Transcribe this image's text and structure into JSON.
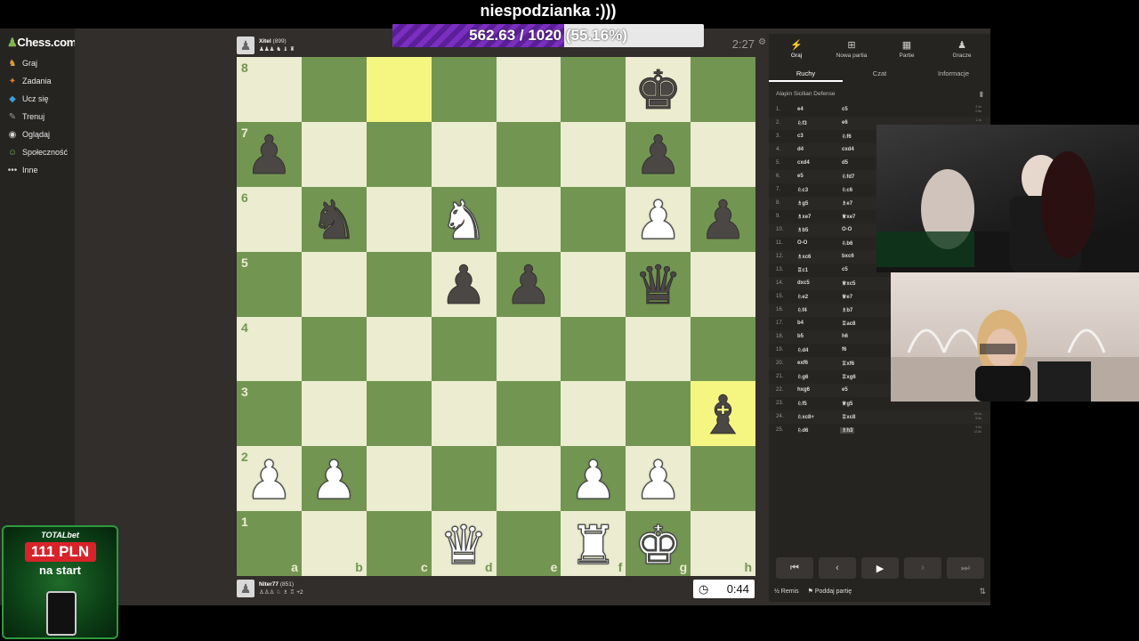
{
  "overlay": {
    "banner": "niespodzianka :)))",
    "goal_text": "562.63 / 1020 (55.16%)",
    "goal_progress": 0.5516
  },
  "sidebar": {
    "logo": "Chess.com",
    "items": [
      {
        "label": "Graj",
        "icon": "play-icon"
      },
      {
        "label": "Zadania",
        "icon": "puzzle-icon"
      },
      {
        "label": "Ucz się",
        "icon": "learn-icon"
      },
      {
        "label": "Trenuj",
        "icon": "train-icon"
      },
      {
        "label": "Oglądaj",
        "icon": "watch-icon"
      },
      {
        "label": "Społeczność",
        "icon": "community-icon"
      },
      {
        "label": "Inne",
        "icon": "more-icon"
      }
    ]
  },
  "top_player": {
    "name": "Xitel",
    "rating": "(899)",
    "captured": "♟♟♟ ♞ ♝ ♜",
    "clock": "2:27"
  },
  "bottom_player": {
    "name": "Niter77",
    "rating": "(851)",
    "captured": "♙♙♙ ♘ ♗ ♖",
    "advantage": "+2",
    "clock": "0:44"
  },
  "board": {
    "files": [
      "a",
      "b",
      "c",
      "d",
      "e",
      "f",
      "g",
      "h"
    ],
    "ranks": [
      "8",
      "7",
      "6",
      "5",
      "4",
      "3",
      "2",
      "1"
    ],
    "highlights": [
      "c8",
      "h3"
    ],
    "pieces": [
      {
        "sq": "g8",
        "glyph": "♚",
        "color": "b"
      },
      {
        "sq": "a7",
        "glyph": "♟",
        "color": "b"
      },
      {
        "sq": "g7",
        "glyph": "♟",
        "color": "b"
      },
      {
        "sq": "b6",
        "glyph": "♞",
        "color": "b"
      },
      {
        "sq": "d6",
        "glyph": "♞",
        "color": "w"
      },
      {
        "sq": "g6",
        "glyph": "♟",
        "color": "w"
      },
      {
        "sq": "h6",
        "glyph": "♟",
        "color": "b"
      },
      {
        "sq": "d5",
        "glyph": "♟",
        "color": "b"
      },
      {
        "sq": "e5",
        "glyph": "♟",
        "color": "b"
      },
      {
        "sq": "g5",
        "glyph": "♛",
        "color": "b"
      },
      {
        "sq": "h3",
        "glyph": "♝",
        "color": "b"
      },
      {
        "sq": "a2",
        "glyph": "♟",
        "color": "w"
      },
      {
        "sq": "b2",
        "glyph": "♟",
        "color": "w"
      },
      {
        "sq": "f2",
        "glyph": "♟",
        "color": "w"
      },
      {
        "sq": "g2",
        "glyph": "♟",
        "color": "w"
      },
      {
        "sq": "d1",
        "glyph": "♛",
        "color": "w"
      },
      {
        "sq": "f1",
        "glyph": "♜",
        "color": "w"
      },
      {
        "sq": "g1",
        "glyph": "♚",
        "color": "w"
      }
    ]
  },
  "panel": {
    "tabs": [
      {
        "label": "Graj",
        "icon": "lightning-icon"
      },
      {
        "label": "Nowa partia",
        "icon": "plus-icon"
      },
      {
        "label": "Partie",
        "icon": "board-icon"
      },
      {
        "label": "Gracze",
        "icon": "players-icon"
      }
    ],
    "subtabs": [
      "Ruchy",
      "Czat",
      "Informacje"
    ],
    "opening": "Alapin Sicilian Defense",
    "moves": [
      {
        "n": "1.",
        "w": "e4",
        "b": "c5",
        "tw": "2.4s",
        "tb": "0.8s"
      },
      {
        "n": "2.",
        "w": "♘f3",
        "b": "e6",
        "tw": "1.1s",
        "tb": ""
      },
      {
        "n": "3.",
        "w": "c3",
        "b": "♘f6"
      },
      {
        "n": "4.",
        "w": "d4",
        "b": "cxd4"
      },
      {
        "n": "5.",
        "w": "cxd4",
        "b": "d5"
      },
      {
        "n": "6.",
        "w": "e5",
        "b": "♘fd7"
      },
      {
        "n": "7.",
        "w": "♘c3",
        "b": "♘c6"
      },
      {
        "n": "8.",
        "w": "♗g5",
        "b": "♗e7"
      },
      {
        "n": "9.",
        "w": "♗xe7",
        "b": "♕xe7"
      },
      {
        "n": "10.",
        "w": "♗b5",
        "b": "O-O"
      },
      {
        "n": "11.",
        "w": "O-O",
        "b": "♘b6"
      },
      {
        "n": "12.",
        "w": "♗xc6",
        "b": "bxc6"
      },
      {
        "n": "13.",
        "w": "♖c1",
        "b": "c5"
      },
      {
        "n": "14.",
        "w": "dxc5",
        "b": "♕xc5"
      },
      {
        "n": "15.",
        "w": "♘e2",
        "b": "♕e7"
      },
      {
        "n": "16.",
        "w": "♘f4",
        "b": "♗b7"
      },
      {
        "n": "17.",
        "w": "b4",
        "b": "♖ac8"
      },
      {
        "n": "18.",
        "w": "b5",
        "b": "h6"
      },
      {
        "n": "19.",
        "w": "♘d4",
        "b": "f6"
      },
      {
        "n": "20.",
        "w": "exf6",
        "b": "♖xf6"
      },
      {
        "n": "21.",
        "w": "♘g6",
        "b": "♖xg6"
      },
      {
        "n": "22.",
        "w": "hxg6",
        "b": "e5"
      },
      {
        "n": "23.",
        "w": "♘f5",
        "b": "♕g5",
        "tw": "16.0s",
        "tb": ""
      },
      {
        "n": "24.",
        "w": "♘xc8+",
        "b": "♖xc8",
        "tw": "29.2s",
        "tb": "5.5s"
      },
      {
        "n": "25.",
        "w": "♘d6",
        "b": "♗h3",
        "tw": "9.9s",
        "tb": "12.8s"
      }
    ],
    "actions": {
      "draw": "½ Remis",
      "resign": "Poddaj partię"
    }
  },
  "ad": {
    "brand": "TOTALbet",
    "amount": "111 PLN",
    "sub": "na start"
  }
}
